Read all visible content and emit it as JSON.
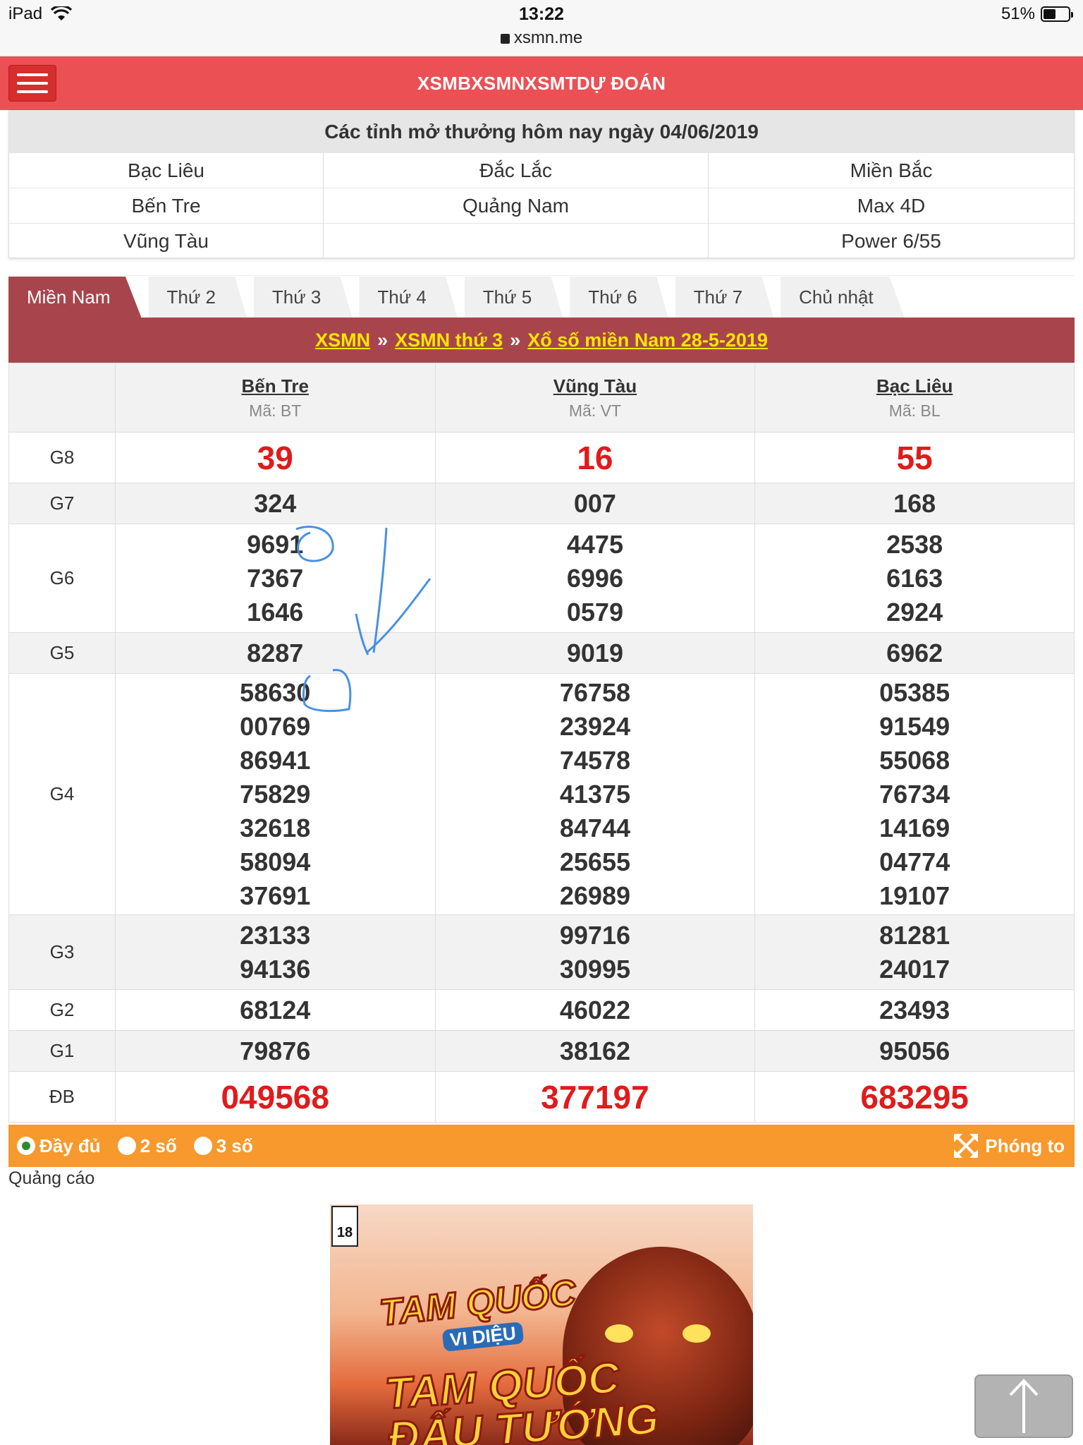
{
  "status_bar": {
    "device": "iPad",
    "time": "13:22",
    "url": "xsmn.me",
    "battery": "51%",
    "battery_level": 0.51
  },
  "nav": {
    "links": [
      "XSMB",
      "XSMN",
      "XSMT",
      "DỰ ĐOÁN"
    ]
  },
  "today": {
    "title": "Các tỉnh mở thưởng hôm nay ngày 04/06/2019",
    "cells": [
      "Bạc Liêu",
      "Đắc Lắc",
      "Miền Bắc",
      "Bến Tre",
      "Quảng Nam",
      "Max 4D",
      "Vũng Tàu",
      "",
      "Power 6/55"
    ]
  },
  "tabs": [
    "Miền Nam",
    "Thứ 2",
    "Thứ 3",
    "Thứ 4",
    "Thứ 5",
    "Thứ 6",
    "Thứ 7",
    "Chủ nhật"
  ],
  "breadcrumb": {
    "items": [
      "XSMN",
      "XSMN thứ 3",
      "Xổ số miền Nam 28-5-2019"
    ],
    "sep": "»"
  },
  "results": {
    "provinces": [
      {
        "name": "Bến Tre",
        "code": "Mã: BT"
      },
      {
        "name": "Vũng Tàu",
        "code": "Mã: VT"
      },
      {
        "name": "Bạc Liêu",
        "code": "Mã: BL"
      }
    ],
    "rows": [
      {
        "label": "G8",
        "values": [
          [
            "39"
          ],
          [
            "16"
          ],
          [
            "55"
          ]
        ]
      },
      {
        "label": "G7",
        "values": [
          [
            "324"
          ],
          [
            "007"
          ],
          [
            "168"
          ]
        ]
      },
      {
        "label": "G6",
        "values": [
          [
            "9691",
            "7367",
            "1646"
          ],
          [
            "4475",
            "6996",
            "0579"
          ],
          [
            "2538",
            "6163",
            "2924"
          ]
        ]
      },
      {
        "label": "G5",
        "values": [
          [
            "8287"
          ],
          [
            "9019"
          ],
          [
            "6962"
          ]
        ]
      },
      {
        "label": "G4",
        "values": [
          [
            "58630",
            "00769",
            "86941",
            "75829",
            "32618",
            "58094",
            "37691"
          ],
          [
            "76758",
            "23924",
            "74578",
            "41375",
            "84744",
            "25655",
            "26989"
          ],
          [
            "05385",
            "91549",
            "55068",
            "76734",
            "14169",
            "04774",
            "19107"
          ]
        ]
      },
      {
        "label": "G3",
        "values": [
          [
            "23133",
            "94136"
          ],
          [
            "99716",
            "30995"
          ],
          [
            "81281",
            "24017"
          ]
        ]
      },
      {
        "label": "G2",
        "values": [
          [
            "68124"
          ],
          [
            "46022"
          ],
          [
            "23493"
          ]
        ]
      },
      {
        "label": "G1",
        "values": [
          [
            "79876"
          ],
          [
            "38162"
          ],
          [
            "95056"
          ]
        ]
      },
      {
        "label": "ĐB",
        "values": [
          [
            "049568"
          ],
          [
            "377197"
          ],
          [
            "683295"
          ]
        ]
      }
    ]
  },
  "options": {
    "full": "Đầy đủ",
    "two": "2 số",
    "three": "3 số",
    "zoom": "Phóng to"
  },
  "ad": {
    "label": "Quảng cáo",
    "badge": "18",
    "line1": "TAM QUỐC",
    "sub": "VI DIỆU",
    "line2": "TAM QUỐC",
    "line3": "ĐẤU TƯỚNG"
  },
  "colors": {
    "nav": "#eb5055",
    "accent": "#a8454c",
    "prize_red": "#e01b1b",
    "options_bar": "#f7992c",
    "link_yellow": "#ffe600"
  }
}
